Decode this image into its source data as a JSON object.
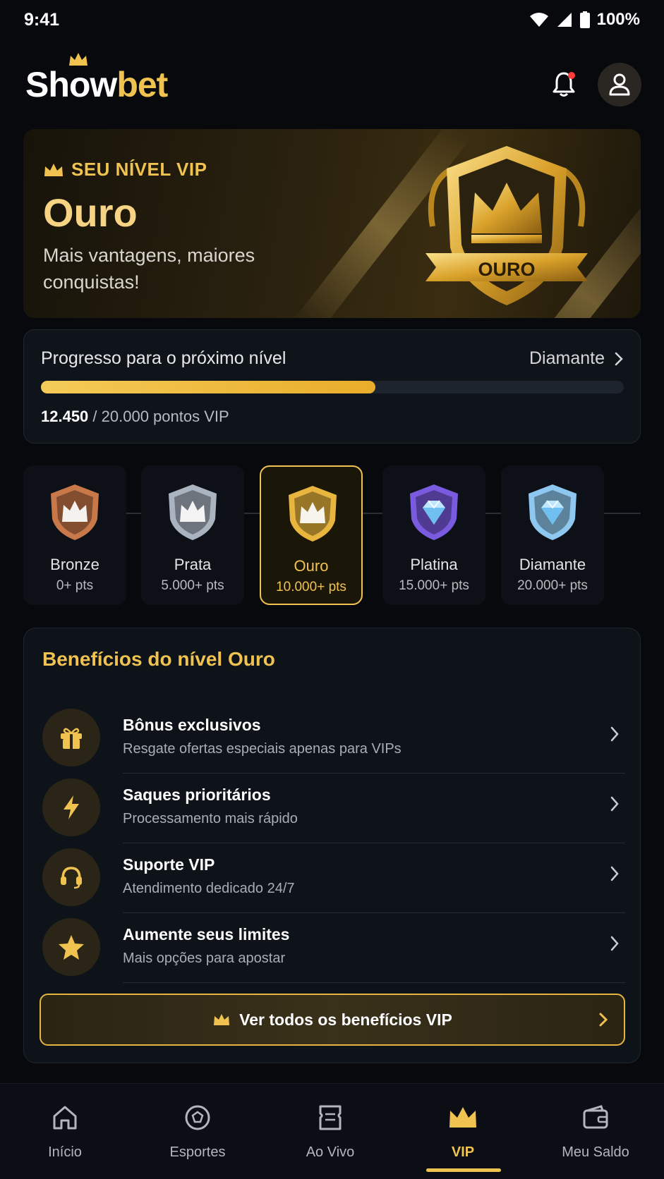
{
  "status_bar": {
    "time": "9:41",
    "battery": "100%"
  },
  "header": {
    "logo_white": "Show",
    "logo_gold": "bet"
  },
  "hero": {
    "eyebrow": "SEU NÍVEL VIP",
    "level": "Ouro",
    "subtitle": "Mais vantagens, maiores conquistas!",
    "badge_label": "OURO"
  },
  "progress": {
    "title": "Progresso para o próximo nível",
    "next_level": "Diamante",
    "current": "12.450",
    "total_text": " / 20.000 pontos VIP",
    "fraction": 0.5735
  },
  "tiers": [
    {
      "name": "Bronze",
      "pts": "0+ pts",
      "color": "#c9784a",
      "icon": "crown-badge-icon"
    },
    {
      "name": "Prata",
      "pts": "5.000+ pts",
      "color": "#aab3c0",
      "icon": "crown-badge-icon"
    },
    {
      "name": "Ouro",
      "pts": "10.000+ pts",
      "color": "#e8b53e",
      "icon": "crown-badge-icon",
      "active": true
    },
    {
      "name": "Platina",
      "pts": "15.000+ pts",
      "color": "#7a5be0",
      "icon": "diamond-badge-icon"
    },
    {
      "name": "Diamante",
      "pts": "20.000+ pts",
      "color": "#8ec8f0",
      "icon": "diamond-badge-icon"
    }
  ],
  "benefits": {
    "title": "Benefícios do nível Ouro",
    "items": [
      {
        "title": "Bônus exclusivos",
        "desc": "Resgate ofertas especiais apenas para VIPs",
        "icon": "gift-icon"
      },
      {
        "title": "Saques prioritários",
        "desc": "Processamento mais rápido",
        "icon": "lightning-icon"
      },
      {
        "title": "Suporte VIP",
        "desc": "Atendimento dedicado 24/7",
        "icon": "headset-icon"
      },
      {
        "title": "Aumente seus limites",
        "desc": "Mais opções para apostar",
        "icon": "star-icon"
      }
    ],
    "cta": "Ver todos os benefícios VIP"
  },
  "nav": {
    "items": [
      {
        "label": "Início",
        "icon": "home-icon"
      },
      {
        "label": "Esportes",
        "icon": "ball-icon"
      },
      {
        "label": "Ao Vivo",
        "icon": "ticket-icon"
      },
      {
        "label": "VIP",
        "icon": "crown-icon",
        "active": true
      },
      {
        "label": "Meu Saldo",
        "icon": "wallet-icon"
      }
    ]
  },
  "colors": {
    "accent": "#f0c250",
    "background": "#07090d",
    "card": "#0e131a"
  }
}
